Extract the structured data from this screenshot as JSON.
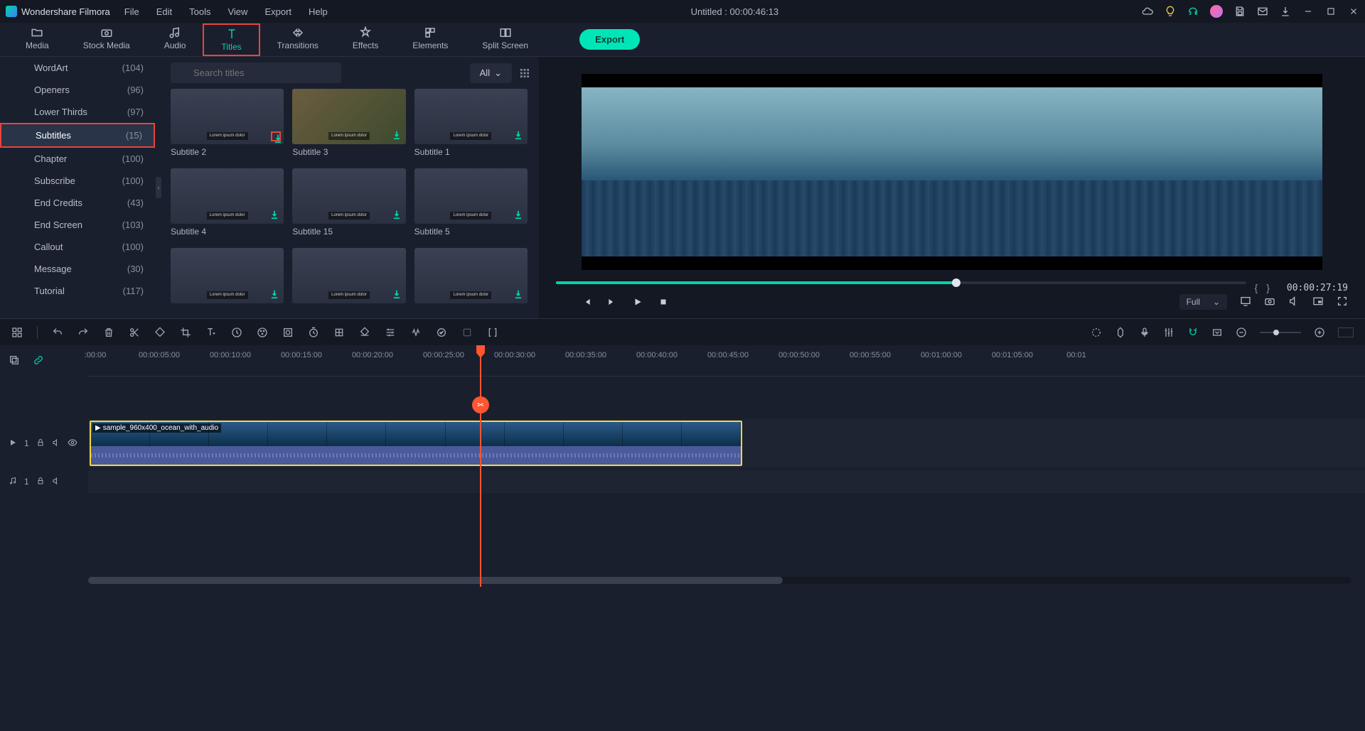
{
  "titlebar": {
    "app_name": "Wondershare Filmora",
    "document_title": "Untitled : 00:00:46:13",
    "menus": [
      "File",
      "Edit",
      "Tools",
      "View",
      "Export",
      "Help"
    ]
  },
  "topnav": {
    "tabs": [
      {
        "label": "Media"
      },
      {
        "label": "Stock Media"
      },
      {
        "label": "Audio"
      },
      {
        "label": "Titles",
        "active": true
      },
      {
        "label": "Transitions"
      },
      {
        "label": "Effects"
      },
      {
        "label": "Elements"
      },
      {
        "label": "Split Screen"
      }
    ],
    "export_label": "Export"
  },
  "sidebar": {
    "items": [
      {
        "label": "WordArt",
        "count": "(104)"
      },
      {
        "label": "Openers",
        "count": "(96)"
      },
      {
        "label": "Lower Thirds",
        "count": "(97)"
      },
      {
        "label": "Subtitles",
        "count": "(15)",
        "active": true
      },
      {
        "label": "Chapter",
        "count": "(100)"
      },
      {
        "label": "Subscribe",
        "count": "(100)"
      },
      {
        "label": "End Credits",
        "count": "(43)"
      },
      {
        "label": "End Screen",
        "count": "(103)"
      },
      {
        "label": "Callout",
        "count": "(100)"
      },
      {
        "label": "Message",
        "count": "(30)"
      },
      {
        "label": "Tutorial",
        "count": "(117)"
      }
    ]
  },
  "search": {
    "placeholder": "Search titles",
    "filter_label": "All"
  },
  "titles_grid": [
    {
      "label": "Subtitle 2"
    },
    {
      "label": "Subtitle 3"
    },
    {
      "label": "Subtitle 1"
    },
    {
      "label": "Subtitle 4"
    },
    {
      "label": "Subtitle 15"
    },
    {
      "label": "Subtitle 5"
    },
    {
      "label": ""
    },
    {
      "label": ""
    },
    {
      "label": ""
    }
  ],
  "preview": {
    "timecode": "00:00:27:19",
    "quality_label": "Full"
  },
  "ruler": [
    ":00:00",
    "00:00:05:00",
    "00:00:10:00",
    "00:00:15:00",
    "00:00:20:00",
    "00:00:25:00",
    "00:00:30:00",
    "00:00:35:00",
    "00:00:40:00",
    "00:00:45:00",
    "00:00:50:00",
    "00:00:55:00",
    "00:01:00:00",
    "00:01:05:00",
    "00:01"
  ],
  "tracks": {
    "video_num": "1",
    "audio_num": "1",
    "clip_name": "sample_960x400_ocean_with_audio"
  }
}
